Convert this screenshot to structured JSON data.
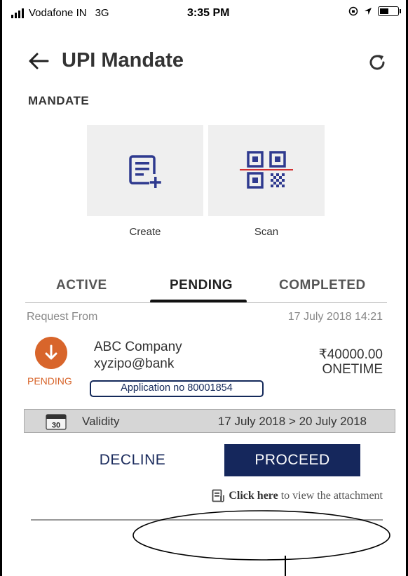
{
  "status_bar": {
    "carrier": "Vodafone IN",
    "network": "3G",
    "time": "3:35 PM"
  },
  "header": {
    "title": "UPI Mandate",
    "back_icon": "arrow-left-icon",
    "refresh_icon": "refresh-icon"
  },
  "section_label": "MANDATE",
  "actions": {
    "create_label": "Create",
    "scan_label": "Scan"
  },
  "tabs": [
    {
      "label": "ACTIVE"
    },
    {
      "label": "PENDING"
    },
    {
      "label": "COMPLETED"
    }
  ],
  "selected_tab": "PENDING",
  "request": {
    "from_label": "Request From",
    "datetime": "17 July 2018 14:21",
    "company": "ABC Company",
    "upi_id": "xyzipo@bank",
    "amount": "₹40000.00",
    "frequency": "ONETIME",
    "status": "PENDING",
    "application_no": "Application no 80001854",
    "calendar_day": "30",
    "validity_label": "Validity",
    "validity_range": "17 July 2018 > 20 July 2018"
  },
  "buttons": {
    "decline": "DECLINE",
    "proceed": "PROCEED"
  },
  "attachment": {
    "click_here": "Click here",
    "rest": "to view the attachment"
  },
  "colors": {
    "accent_navy": "#15275c",
    "pending_orange": "#d8652b",
    "tile_bg": "#efefef",
    "icon_blue": "#2f3a8f"
  }
}
